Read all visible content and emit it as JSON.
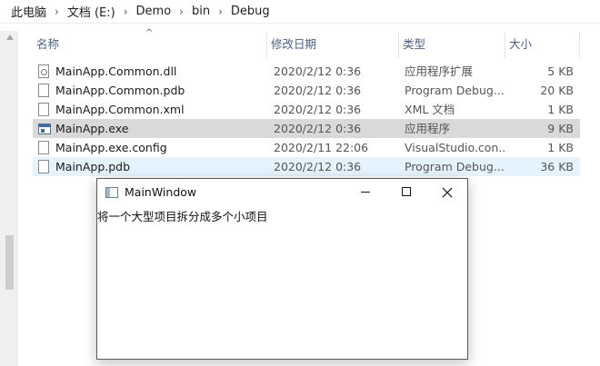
{
  "breadcrumb": [
    "此电脑",
    "文档 (E:)",
    "Demo",
    "bin",
    "Debug"
  ],
  "breadcrumb_separator": "›",
  "columns": {
    "name": "名称",
    "date": "修改日期",
    "type": "类型",
    "size": "大小"
  },
  "sort_indicator": "^",
  "files": [
    {
      "name": "MainApp.Common.dll",
      "date": "2020/2/12 0:36",
      "type": "应用程序扩展",
      "size": "5 KB",
      "icon": "dll-file-icon"
    },
    {
      "name": "MainApp.Common.pdb",
      "date": "2020/2/12 0:36",
      "type": "Program Debug...",
      "size": "20 KB",
      "icon": "file-icon"
    },
    {
      "name": "MainApp.Common.xml",
      "date": "2020/2/12 0:36",
      "type": "XML 文档",
      "size": "1 KB",
      "icon": "file-icon"
    },
    {
      "name": "MainApp.exe",
      "date": "2020/2/12 0:36",
      "type": "应用程序",
      "size": "9 KB",
      "icon": "exe-file-icon"
    },
    {
      "name": "MainApp.exe.config",
      "date": "2020/2/11 22:06",
      "type": "VisualStudio.con...",
      "size": "1 KB",
      "icon": "file-icon"
    },
    {
      "name": "MainApp.pdb",
      "date": "2020/2/12 0:36",
      "type": "Program Debug...",
      "size": "36 KB",
      "icon": "file-icon"
    }
  ],
  "selected_row": "MainApp.exe",
  "hovered_row": "MainApp.pdb",
  "window": {
    "title": "MainWindow",
    "content_text": "将一个大型项目拆分成多个小项目"
  },
  "colors": {
    "selected_row": "#d9d9d9",
    "hover_row": "#e5f3ff",
    "header_text": "#4d6082"
  }
}
